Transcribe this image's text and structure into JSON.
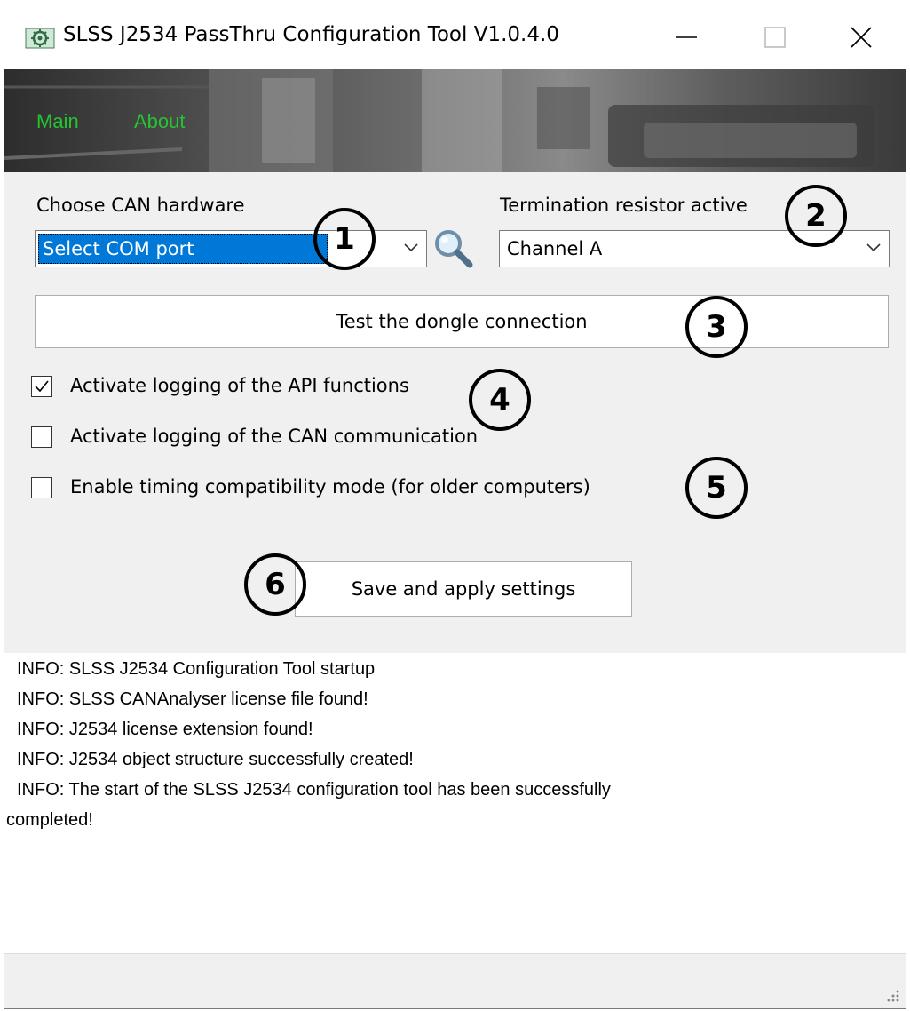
{
  "window": {
    "title": "SLSS J2534 PassThru Configuration Tool V1.0.4.0",
    "icon": "app-gear-icon",
    "controls": {
      "minimize": "minimize-icon",
      "maximize": "maximize-icon",
      "close": "close-icon"
    }
  },
  "nav": {
    "items": [
      {
        "label": "Main"
      },
      {
        "label": "About"
      }
    ]
  },
  "hardware": {
    "label": "Choose CAN hardware",
    "value": "Select COM port",
    "search_icon": "magnifier-icon"
  },
  "termination": {
    "label": "Termination resistor active",
    "value": "Channel A"
  },
  "test_button": {
    "label": "Test the dongle connection"
  },
  "options": [
    {
      "label": "Activate logging of the API functions",
      "checked": true
    },
    {
      "label": "Activate logging of the CAN communication",
      "checked": false
    },
    {
      "label": "Enable timing compatibility mode (for older computers)",
      "checked": false
    }
  ],
  "save_button": {
    "label": "Save and apply settings"
  },
  "log": {
    "lines": [
      "INFO: SLSS J2534 Configuration Tool startup",
      "INFO: SLSS CANAnalyser license file found!",
      "INFO: J2534 license extension found!",
      "INFO: J2534 object structure successfully created!",
      "INFO: The start of the SLSS J2534 configuration tool has been successfully",
      "completed!"
    ]
  },
  "callouts": [
    "1",
    "2",
    "3",
    "4",
    "5",
    "6"
  ],
  "colors": {
    "nav_text": "#25c431",
    "selection": "#0078d7"
  }
}
